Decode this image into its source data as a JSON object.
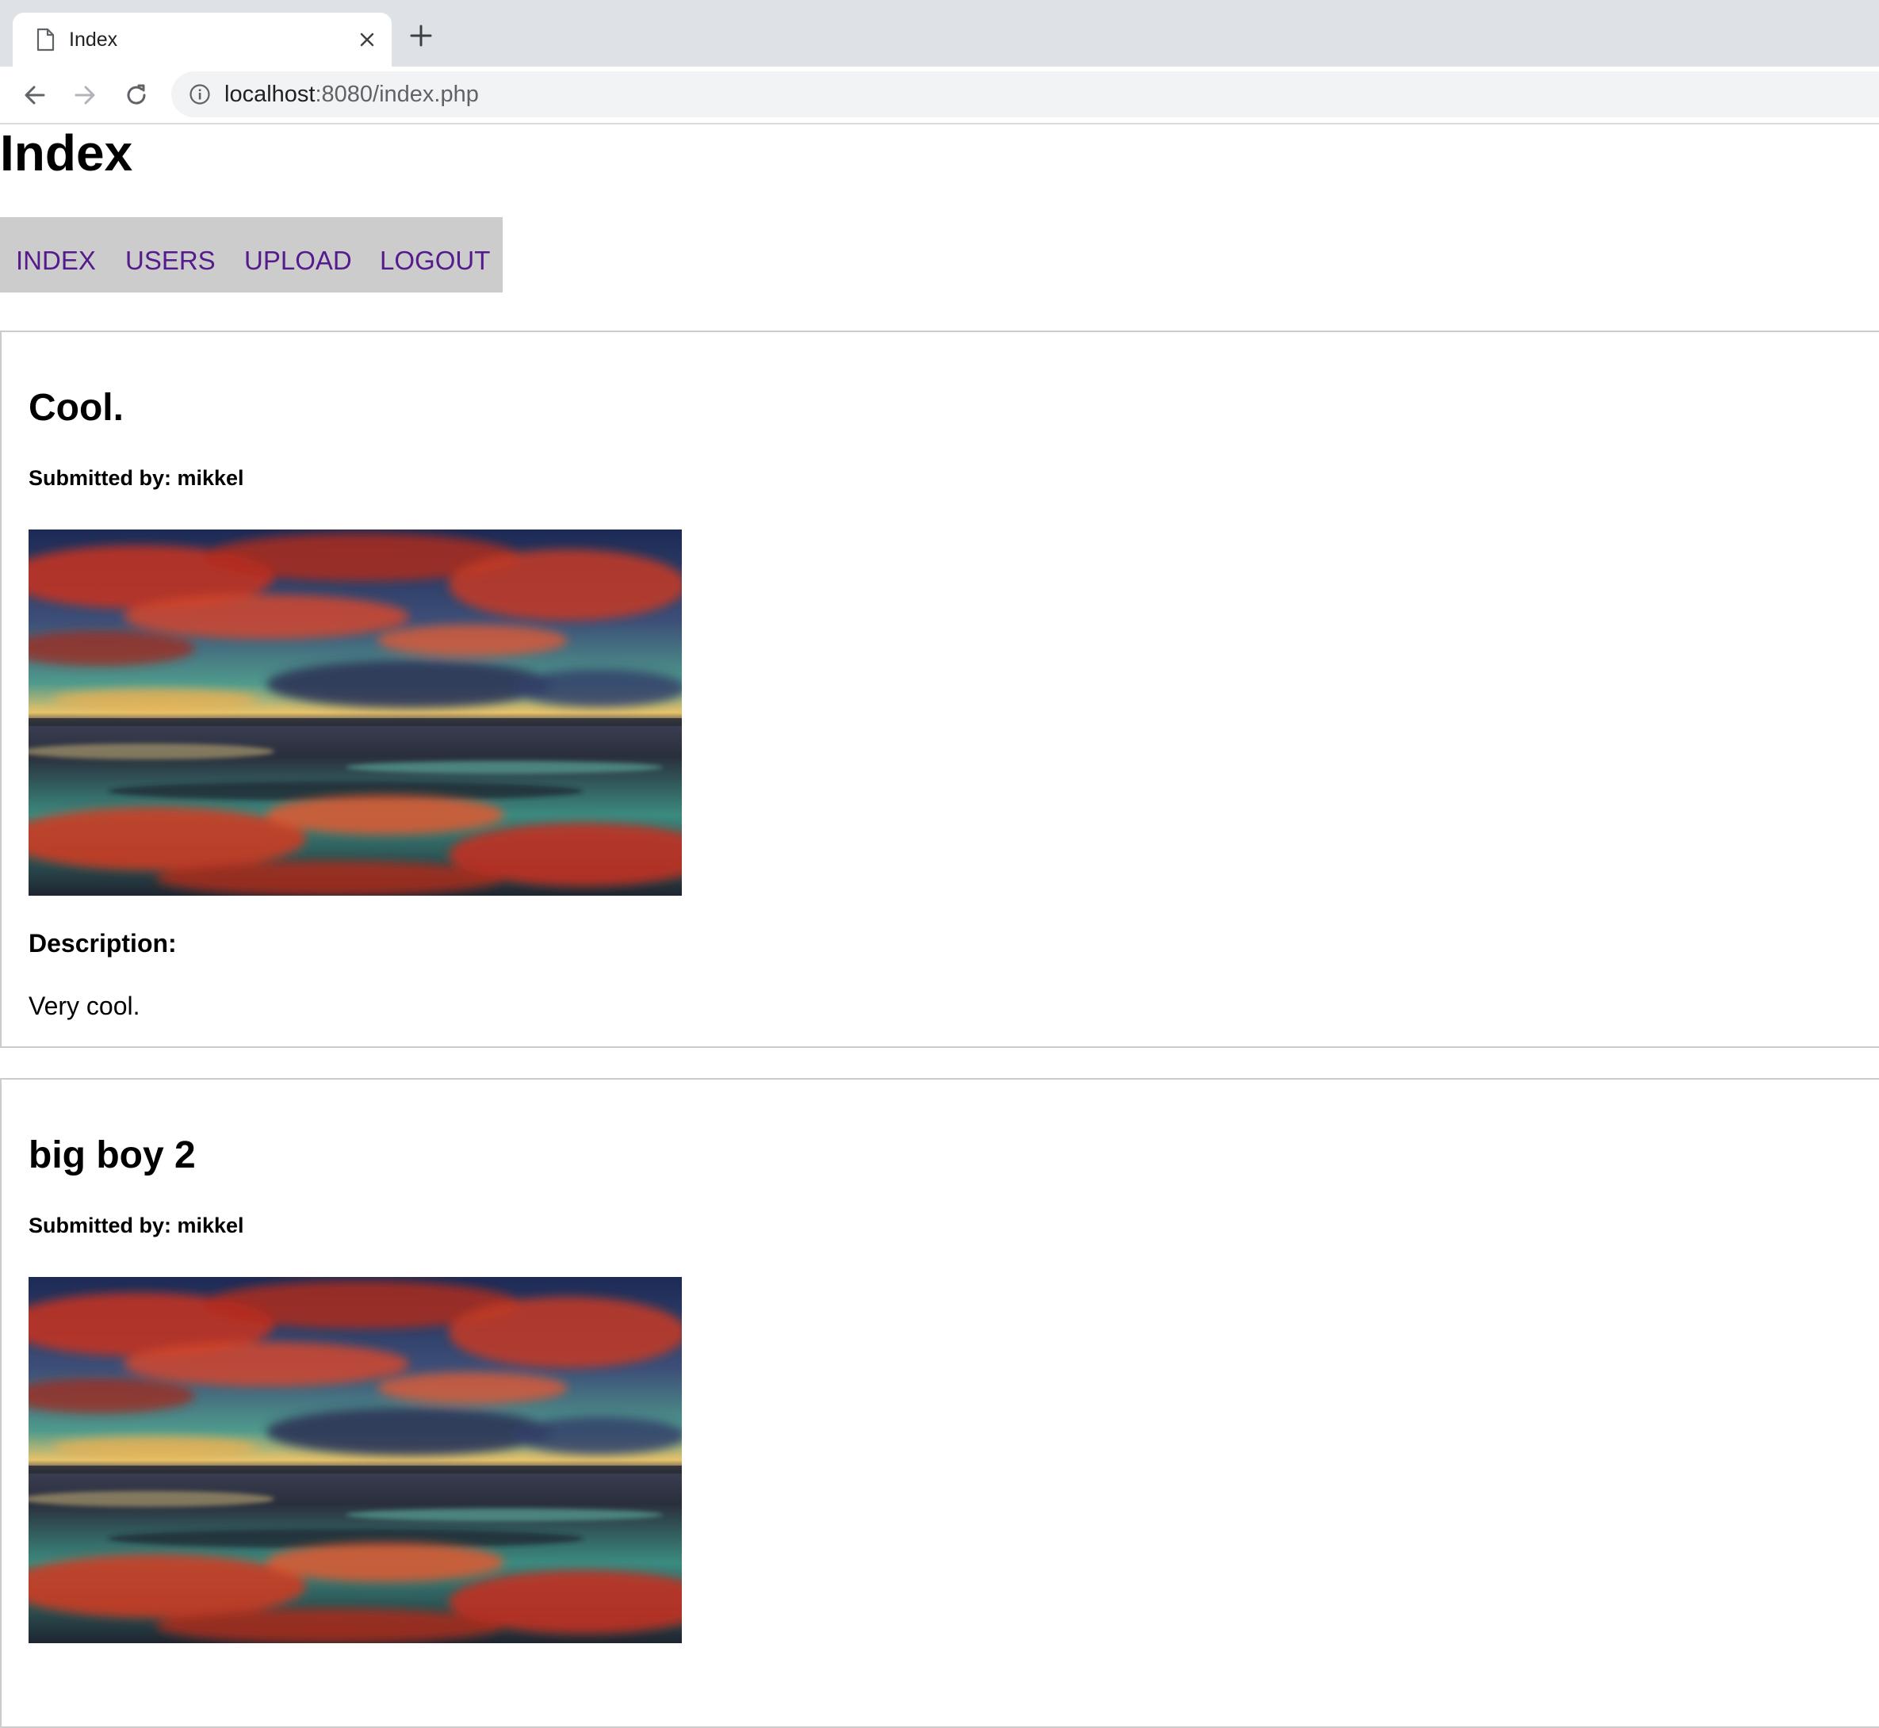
{
  "browser": {
    "tab_title": "Index",
    "url_host": "localhost",
    "url_rest": ":8080/index.php"
  },
  "page": {
    "title": "Index"
  },
  "nav": {
    "items": [
      {
        "label": "INDEX"
      },
      {
        "label": "USERS"
      },
      {
        "label": "UPLOAD"
      },
      {
        "label": "LOGOUT"
      }
    ],
    "link_color": "#551a8b",
    "bar_color": "#cccccc"
  },
  "posts": [
    {
      "title": "Cool.",
      "submitted": "Submitted by: mikkel",
      "description_label": "Description:",
      "description": "Very cool."
    },
    {
      "title": "big boy 2",
      "submitted": "Submitted by: mikkel"
    }
  ]
}
